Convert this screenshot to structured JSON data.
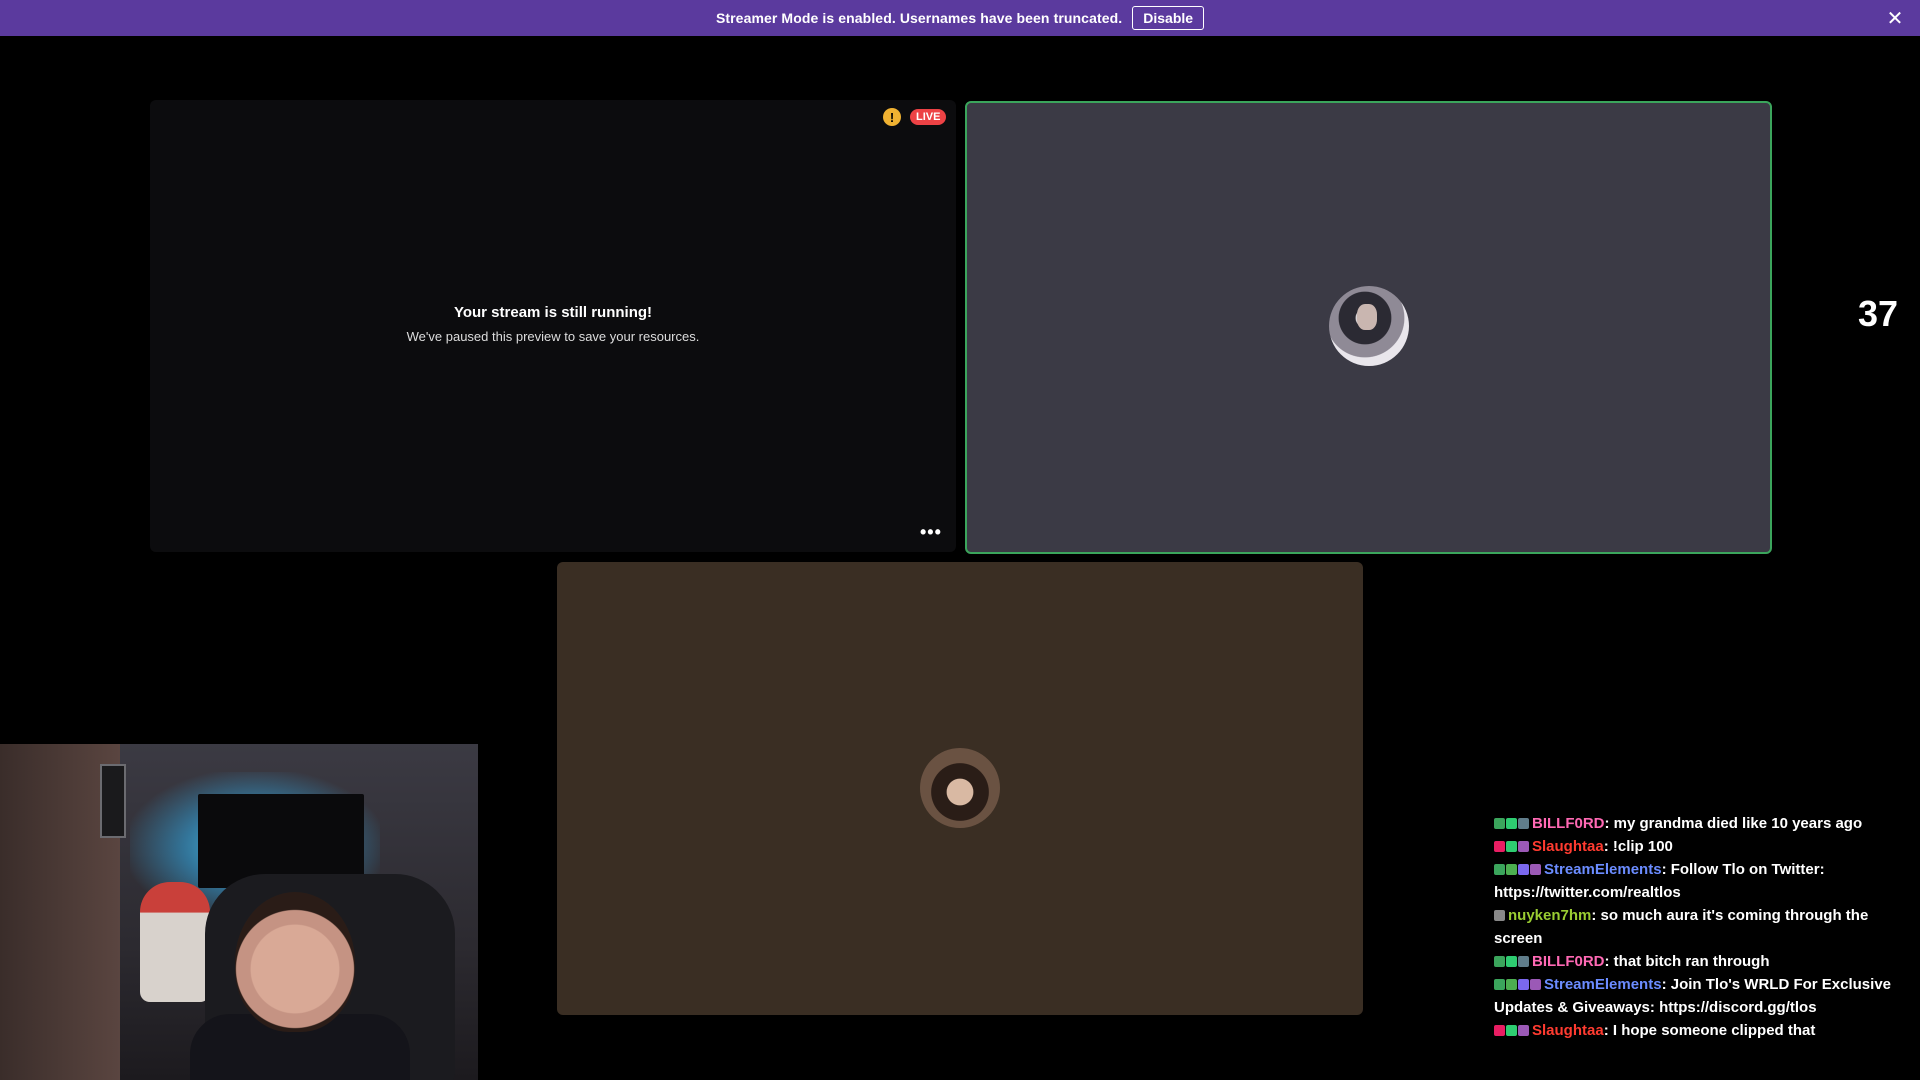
{
  "banner": {
    "text": "Streamer Mode is enabled. Usernames have been truncated.",
    "button_label": "Disable",
    "close_icon": "close-icon"
  },
  "stream_tile": {
    "title": "Your stream is still running!",
    "subtitle": "We've paused this preview to save your resources.",
    "live_label": "LIVE",
    "warning_symbol": "!",
    "more_symbol": "•••"
  },
  "side_count": "37",
  "chat": {
    "messages": [
      {
        "user": "BILLF0RD",
        "user_color": "#ff69b4",
        "text": "my grandma died like 10 years ago",
        "badges": [
          "#3ba55c",
          "#2ecc71",
          "#607d8b"
        ]
      },
      {
        "user": "Slaughtaa",
        "user_color": "#ff3b30",
        "text": "!clip 100",
        "badges": [
          "#e91e63",
          "#2ecc71",
          "#9b59b6"
        ]
      },
      {
        "user": "StreamElements",
        "user_color": "#6b8cff",
        "text": "Follow Tlo on Twitter: https://twitter.com/realtlos",
        "badges": [
          "#3ba55c",
          "#4caf50",
          "#7b68ee",
          "#9b59b6"
        ]
      },
      {
        "user": "nuyken7hm",
        "user_color": "#9acd32",
        "text": "so much aura it's coming through the screen",
        "badges": [
          "#888888"
        ]
      },
      {
        "user": "BILLF0RD",
        "user_color": "#ff69b4",
        "text": "that bitch ran through",
        "badges": [
          "#3ba55c",
          "#2ecc71",
          "#607d8b"
        ]
      },
      {
        "user": "StreamElements",
        "user_color": "#6b8cff",
        "text": "Join Tlo's WRLD For Exclusive Updates & Giveaways: https://discord.gg/tlos",
        "badges": [
          "#3ba55c",
          "#4caf50",
          "#7b68ee",
          "#9b59b6"
        ]
      },
      {
        "user": "Slaughtaa",
        "user_color": "#ff3b30",
        "text": "I hope someone clipped that",
        "badges": [
          "#e91e63",
          "#2ecc71",
          "#9b59b6"
        ]
      }
    ]
  }
}
